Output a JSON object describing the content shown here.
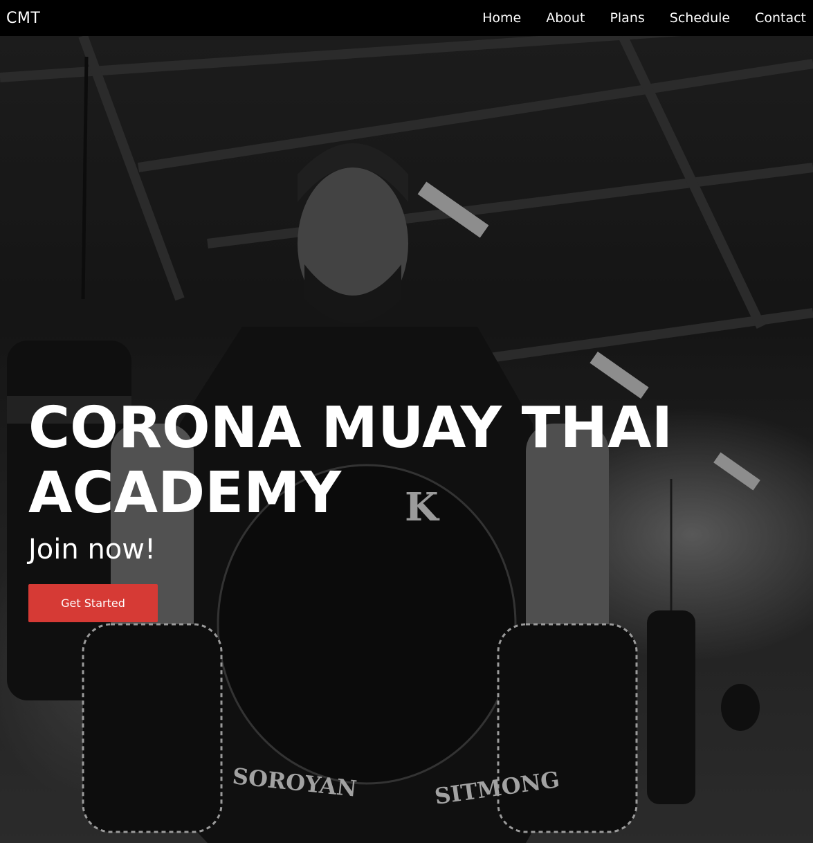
{
  "navbar": {
    "brand": "CMT",
    "links": [
      "Home",
      "About",
      "Plans",
      "Schedule",
      "Contact"
    ]
  },
  "hero": {
    "title": "CORONA MUAY THAI ACADEMY",
    "subtitle": "Join now!",
    "cta_label": "Get Started"
  },
  "colors": {
    "navbar_bg": "#000000",
    "accent": "#d63a35",
    "text": "#ffffff"
  }
}
